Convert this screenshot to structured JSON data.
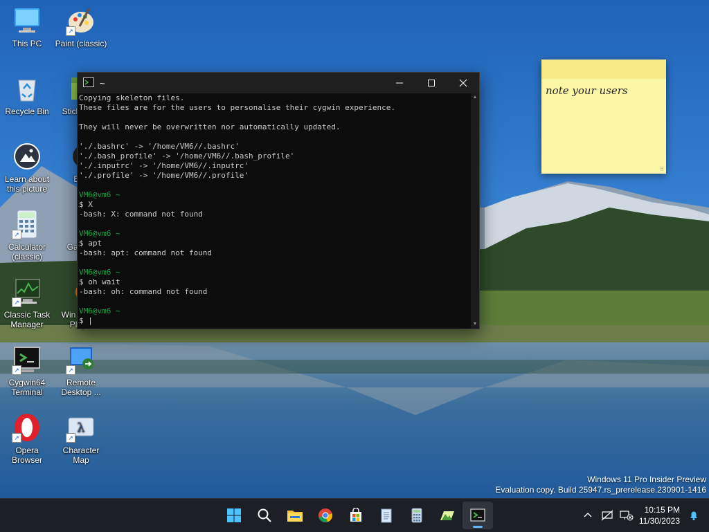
{
  "desktop": {
    "icons": [
      {
        "label": "This PC",
        "icon": "this-pc-icon"
      },
      {
        "label": "Paint (classic)",
        "icon": "paint-icon"
      },
      {
        "label": "Recycle Bin",
        "icon": "recycle-bin-icon"
      },
      {
        "label": "Sticky (cla",
        "icon": "sticky-notes-icon"
      },
      {
        "label": "Learn about this picture",
        "icon": "learn-about-picture-icon"
      },
      {
        "label": "Ban",
        "icon": "bandicam-icon"
      },
      {
        "label": "Calculator (classic)",
        "icon": "calculator-icon"
      },
      {
        "label": "Ga Sho",
        "icon": "game-shortcut-icon"
      },
      {
        "label": "Classic Task Manager",
        "icon": "task-manager-icon"
      },
      {
        "label": "Win Media Play...",
        "icon": "media-player-icon"
      },
      {
        "label": "Cygwin64 Terminal",
        "icon": "cygwin-terminal-icon"
      },
      {
        "label": "Remote Desktop ...",
        "icon": "remote-desktop-icon"
      },
      {
        "label": "Opera Browser",
        "icon": "opera-icon"
      },
      {
        "label": "Character Map",
        "icon": "character-map-icon"
      }
    ]
  },
  "terminal": {
    "title": "~",
    "lines": [
      {
        "text": "Copying skeleton files."
      },
      {
        "text": "These files are for the users to personalise their cygwin experience."
      },
      {
        "text": ""
      },
      {
        "text": "They will never be overwritten nor automatically updated."
      },
      {
        "text": ""
      },
      {
        "text": "'./.bashrc' -> '/home/VM6//.bashrc'"
      },
      {
        "text": "'./.bash_profile' -> '/home/VM6//.bash_profile'"
      },
      {
        "text": "'./.inputrc' -> '/home/VM6//.inputrc'"
      },
      {
        "text": "'./.profile' -> '/home/VM6//.profile'"
      },
      {
        "text": ""
      },
      {
        "text": "VM6@vm6 ~",
        "prompt": true
      },
      {
        "text": "$ X"
      },
      {
        "text": "-bash: X: command not found"
      },
      {
        "text": ""
      },
      {
        "text": "VM6@vm6 ~",
        "prompt": true
      },
      {
        "text": "$ apt"
      },
      {
        "text": "-bash: apt: command not found"
      },
      {
        "text": ""
      },
      {
        "text": "VM6@vm6 ~",
        "prompt": true
      },
      {
        "text": "$ oh wait"
      },
      {
        "text": "-bash: oh: command not found"
      },
      {
        "text": ""
      },
      {
        "text": "VM6@vm6 ~",
        "prompt": true
      },
      {
        "text": "$ |"
      }
    ],
    "colors": {
      "prompt": "#16a34a",
      "text": "#cccccc",
      "background": "#0c0c0c"
    }
  },
  "sticky": {
    "text": "note your users",
    "color": "#fdf7a8"
  },
  "watermark": {
    "line1": "Windows 11 Pro Insider Preview",
    "line2": "Evaluation copy. Build 25947.rs_prerelease.230901-1416"
  },
  "taskbar": {
    "apps": [
      "start-icon",
      "search-icon",
      "file-explorer-icon",
      "chrome-icon",
      "store-icon",
      "notepad-icon",
      "calculator-icon",
      "photos-icon",
      "cygwin-terminal-icon"
    ],
    "active_app": "cygwin-terminal-icon",
    "clock": {
      "time": "10:15 PM",
      "date": "11/30/2023"
    }
  }
}
